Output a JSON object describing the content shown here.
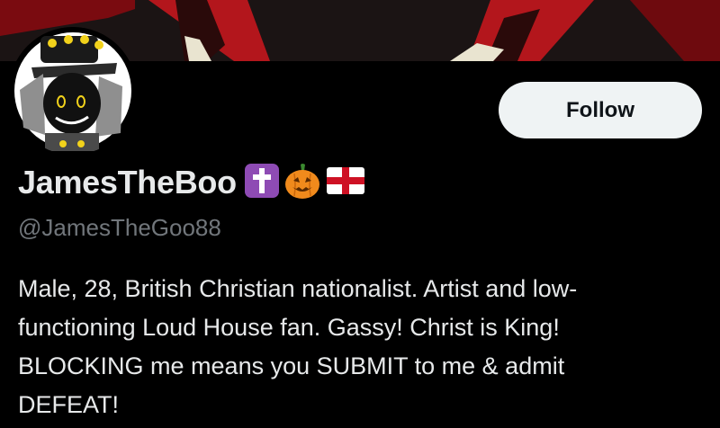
{
  "profile": {
    "display_name": "JamesTheBoo",
    "handle": "@JamesTheGoo88",
    "bio_lines": [
      "Male, 28, British Christian nationalist. Artist and low-",
      "functioning Loud House fan. Gassy! Christ is King!",
      "BLOCKING me means you SUBMIT to me & admit",
      "DEFEAT!"
    ],
    "name_badges": [
      "latin-cross-icon",
      "jack-o-lantern-icon",
      "england-flag-icon"
    ]
  },
  "actions": {
    "follow_label": "Follow"
  },
  "colors": {
    "background": "#000000",
    "primary_text": "#e7e9ea",
    "secondary_text": "#71767b",
    "follow_button_bg": "#eff3f4",
    "banner_red": "#b3161c",
    "cross_badge": "#8e4bb4"
  }
}
